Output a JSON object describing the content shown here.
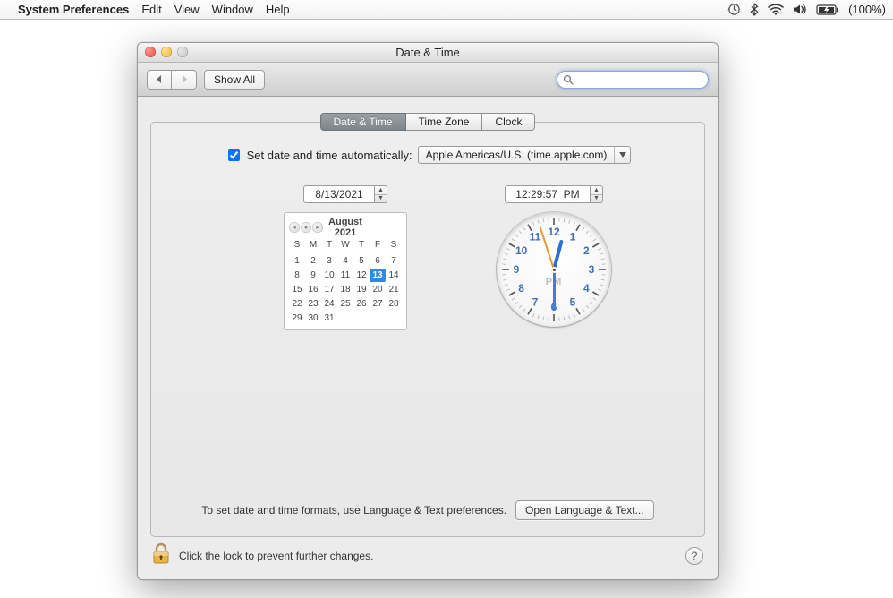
{
  "menubar": {
    "app": "System Preferences",
    "items": [
      "Edit",
      "View",
      "Window",
      "Help"
    ],
    "battery": "(100%)"
  },
  "window": {
    "title": "Date & Time",
    "show_all": "Show All",
    "search_placeholder": ""
  },
  "tabs": [
    "Date & Time",
    "Time Zone",
    "Clock"
  ],
  "selected_tab": 0,
  "auto_time": {
    "label": "Set date and time automatically:",
    "checked": true,
    "server": "Apple Americas/U.S. (time.apple.com)"
  },
  "date_field": "8/13/2021",
  "time_field": "12:29:57  PM",
  "calendar": {
    "title": "August 2021",
    "dow": [
      "S",
      "M",
      "T",
      "W",
      "T",
      "F",
      "S"
    ],
    "leading_blanks": 0,
    "days_in_month": 31,
    "today": 13
  },
  "clock": {
    "ampm": "PM",
    "hour_angle": 15,
    "minute_angle": 180,
    "second_angle": 342,
    "numerals": [
      "12",
      "1",
      "2",
      "3",
      "4",
      "5",
      "6",
      "7",
      "8",
      "9",
      "10",
      "11"
    ]
  },
  "format_hint": "To set date and time formats, use Language & Text preferences.",
  "open_lang_btn": "Open Language & Text...",
  "lock_hint": "Click the lock to prevent further changes."
}
